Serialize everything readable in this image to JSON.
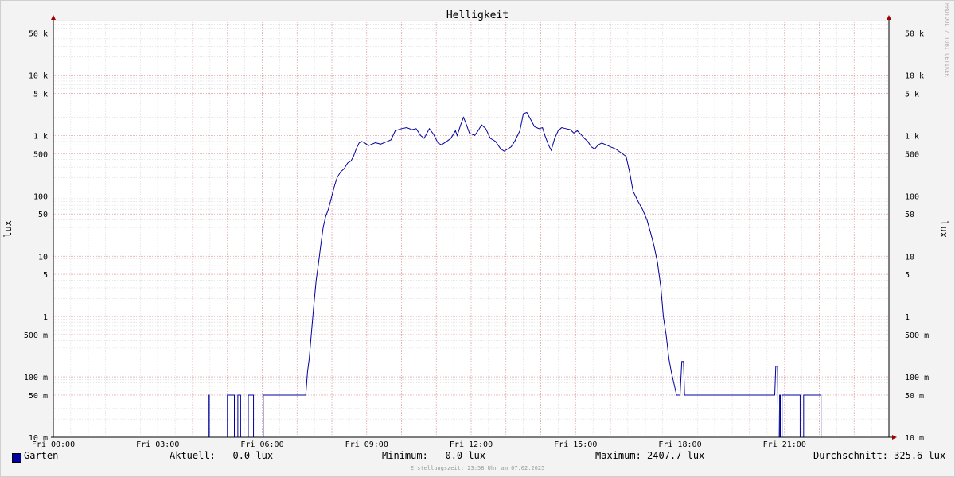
{
  "watermark": "RRDTOOL / TOBI OETIKER",
  "chart_data": {
    "type": "line",
    "title": "Helligkeit",
    "ylabel": "lux",
    "yscale": "log",
    "ylim": [
      0.01,
      80000
    ],
    "xlim": [
      0,
      24
    ],
    "x_ticks": [
      {
        "x": 0,
        "label": "Fri 00:00"
      },
      {
        "x": 3,
        "label": "Fri 03:00"
      },
      {
        "x": 6,
        "label": "Fri 06:00"
      },
      {
        "x": 9,
        "label": "Fri 09:00"
      },
      {
        "x": 12,
        "label": "Fri 12:00"
      },
      {
        "x": 15,
        "label": "Fri 15:00"
      },
      {
        "x": 18,
        "label": "Fri 18:00"
      },
      {
        "x": 21,
        "label": "Fri 21:00"
      }
    ],
    "y_ticks": [
      {
        "v": 50000,
        "label": "50 k"
      },
      {
        "v": 10000,
        "label": "10 k"
      },
      {
        "v": 5000,
        "label": "5 k"
      },
      {
        "v": 1000,
        "label": "1 k"
      },
      {
        "v": 500,
        "label": "500"
      },
      {
        "v": 100,
        "label": "100"
      },
      {
        "v": 50,
        "label": "50"
      },
      {
        "v": 10,
        "label": "10"
      },
      {
        "v": 5,
        "label": "5"
      },
      {
        "v": 1,
        "label": "1"
      },
      {
        "v": 0.5,
        "label": "500 m"
      },
      {
        "v": 0.1,
        "label": "100 m"
      },
      {
        "v": 0.05,
        "label": "50 m"
      },
      {
        "v": 0.01,
        "label": "10 m"
      }
    ],
    "grid": true,
    "series": [
      {
        "name": "Garten",
        "color": "#0000a0",
        "points": [
          [
            0.0,
            0.01
          ],
          [
            4.45,
            0.01
          ],
          [
            4.45,
            0.05
          ],
          [
            4.48,
            0.05
          ],
          [
            4.48,
            0.01
          ],
          [
            5.0,
            0.01
          ],
          [
            5.0,
            0.05
          ],
          [
            5.2,
            0.05
          ],
          [
            5.2,
            0.01
          ],
          [
            5.3,
            0.01
          ],
          [
            5.3,
            0.05
          ],
          [
            5.38,
            0.05
          ],
          [
            5.38,
            0.01
          ],
          [
            5.6,
            0.01
          ],
          [
            5.6,
            0.05
          ],
          [
            5.75,
            0.05
          ],
          [
            5.75,
            0.01
          ],
          [
            6.03,
            0.01
          ],
          [
            6.03,
            0.05
          ],
          [
            7.25,
            0.05
          ],
          [
            7.3,
            0.12
          ],
          [
            7.35,
            0.2
          ],
          [
            7.42,
            0.6
          ],
          [
            7.48,
            1.5
          ],
          [
            7.55,
            4
          ],
          [
            7.62,
            8
          ],
          [
            7.68,
            15
          ],
          [
            7.75,
            30
          ],
          [
            7.82,
            45
          ],
          [
            7.9,
            60
          ],
          [
            8.0,
            100
          ],
          [
            8.08,
            150
          ],
          [
            8.15,
            200
          ],
          [
            8.25,
            250
          ],
          [
            8.35,
            280
          ],
          [
            8.45,
            350
          ],
          [
            8.55,
            380
          ],
          [
            8.62,
            450
          ],
          [
            8.7,
            600
          ],
          [
            8.78,
            750
          ],
          [
            8.85,
            800
          ],
          [
            8.95,
            750
          ],
          [
            9.05,
            680
          ],
          [
            9.15,
            720
          ],
          [
            9.25,
            760
          ],
          [
            9.4,
            720
          ],
          [
            9.55,
            780
          ],
          [
            9.7,
            850
          ],
          [
            9.82,
            1200
          ],
          [
            10.0,
            1300
          ],
          [
            10.15,
            1350
          ],
          [
            10.3,
            1250
          ],
          [
            10.42,
            1300
          ],
          [
            10.55,
            1000
          ],
          [
            10.65,
            900
          ],
          [
            10.8,
            1300
          ],
          [
            10.92,
            1050
          ],
          [
            11.05,
            750
          ],
          [
            11.15,
            700
          ],
          [
            11.3,
            800
          ],
          [
            11.42,
            900
          ],
          [
            11.55,
            1200
          ],
          [
            11.6,
            1000
          ],
          [
            11.7,
            1500
          ],
          [
            11.78,
            2000
          ],
          [
            11.85,
            1600
          ],
          [
            11.95,
            1100
          ],
          [
            12.1,
            1000
          ],
          [
            12.2,
            1200
          ],
          [
            12.3,
            1500
          ],
          [
            12.42,
            1300
          ],
          [
            12.55,
            900
          ],
          [
            12.7,
            800
          ],
          [
            12.85,
            600
          ],
          [
            12.95,
            550
          ],
          [
            13.05,
            600
          ],
          [
            13.15,
            650
          ],
          [
            13.25,
            800
          ],
          [
            13.4,
            1200
          ],
          [
            13.5,
            2300
          ],
          [
            13.6,
            2407.7
          ],
          [
            13.72,
            1800
          ],
          [
            13.82,
            1400
          ],
          [
            13.95,
            1300
          ],
          [
            14.05,
            1350
          ],
          [
            14.12,
            1000
          ],
          [
            14.22,
            700
          ],
          [
            14.3,
            570
          ],
          [
            14.4,
            900
          ],
          [
            14.5,
            1200
          ],
          [
            14.6,
            1350
          ],
          [
            14.72,
            1300
          ],
          [
            14.85,
            1250
          ],
          [
            14.95,
            1100
          ],
          [
            15.05,
            1200
          ],
          [
            15.15,
            1050
          ],
          [
            15.25,
            900
          ],
          [
            15.35,
            800
          ],
          [
            15.45,
            650
          ],
          [
            15.55,
            600
          ],
          [
            15.65,
            700
          ],
          [
            15.75,
            750
          ],
          [
            15.88,
            700
          ],
          [
            16.0,
            650
          ],
          [
            16.15,
            600
          ],
          [
            16.3,
            520
          ],
          [
            16.45,
            450
          ],
          [
            16.55,
            250
          ],
          [
            16.65,
            120
          ],
          [
            16.8,
            80
          ],
          [
            16.92,
            60
          ],
          [
            17.05,
            40
          ],
          [
            17.15,
            25
          ],
          [
            17.25,
            15
          ],
          [
            17.35,
            8
          ],
          [
            17.45,
            3
          ],
          [
            17.52,
            1
          ],
          [
            17.6,
            0.5
          ],
          [
            17.68,
            0.2
          ],
          [
            17.75,
            0.12
          ],
          [
            17.82,
            0.08
          ],
          [
            17.9,
            0.05
          ],
          [
            17.98,
            0.05
          ],
          [
            18.0,
            0.05
          ],
          [
            18.05,
            0.18
          ],
          [
            18.1,
            0.18
          ],
          [
            18.13,
            0.05
          ],
          [
            20.72,
            0.05
          ],
          [
            20.75,
            0.15
          ],
          [
            20.8,
            0.15
          ],
          [
            20.82,
            0.01
          ],
          [
            20.86,
            0.01
          ],
          [
            20.86,
            0.05
          ],
          [
            20.88,
            0.05
          ],
          [
            20.88,
            0.01
          ],
          [
            20.93,
            0.01
          ],
          [
            20.93,
            0.05
          ],
          [
            21.45,
            0.05
          ],
          [
            21.45,
            0.01
          ],
          [
            21.55,
            0.01
          ],
          [
            21.55,
            0.05
          ],
          [
            22.05,
            0.05
          ],
          [
            22.05,
            0.01
          ],
          [
            24.0,
            0.01
          ]
        ]
      }
    ]
  },
  "legend": {
    "series_label": "Garten",
    "current": "Aktuell:   0.0 lux",
    "minimum": "Minimum:   0.0 lux",
    "maximum": "Maximum: 2407.7 lux",
    "average": "Durchschnitt: 325.6 lux"
  },
  "footer": "Erstellungszeit: 23:58 Uhr am 07.02.2025"
}
